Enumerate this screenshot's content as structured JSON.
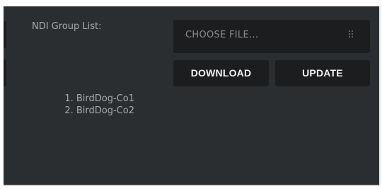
{
  "ndi": {
    "group_list_label": "NDI Group List:",
    "groups": [
      "1. BirdDog-Co1",
      "2. BirdDog-Co2"
    ]
  },
  "file": {
    "placeholder": "CHOOSE FILE..."
  },
  "actions": {
    "download_label": "DOWNLOAD",
    "update_label": "UPDATE"
  },
  "icons": {
    "file_handle": "grip-dots-icon"
  },
  "colors": {
    "panel_background": "#2b2e30",
    "control_background": "#1b1d1f",
    "label_text": "#a7abad",
    "button_text": "#f2f3f4"
  }
}
